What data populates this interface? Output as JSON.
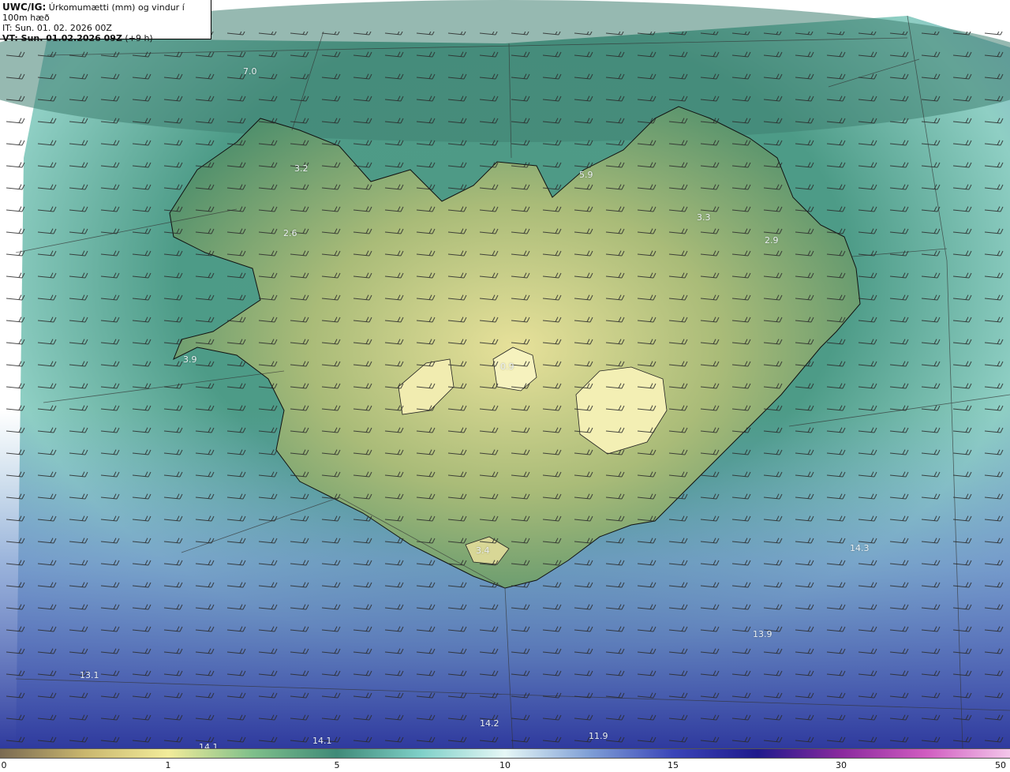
{
  "header": {
    "model": "UWC/IG:",
    "title": " Úrkomumætti (mm) og vindur í 100m hæð",
    "it_line": "IT: Sun. 01. 02. 2026 00Z",
    "vt_line": "VT: Sun. 01.02.2026 09Z",
    "vt_offset": " (+9 h)"
  },
  "value_labels": [
    "7.0",
    "3.2",
    "5.9",
    "3.3",
    "2.6",
    "2.9",
    "3.9",
    "0.9",
    "3.4",
    "14.3",
    "13.9",
    "13.1",
    "14.2",
    "14.1",
    "11.9",
    "14.1"
  ],
  "colorbar": {
    "ticks": [
      "0",
      "1",
      "5",
      "10",
      "15",
      "30",
      "50"
    ],
    "colors": [
      "#7a6a52",
      "#c9b66e",
      "#f2ec9a",
      "#7fbf8a",
      "#3f8a78",
      "#7fd0c8",
      "#e6f7f6",
      "#7f9fd6",
      "#3b45b8",
      "#1f1a8c",
      "#8a2a9e",
      "#d05cc0",
      "#f3c6ea"
    ]
  },
  "icons": {
    "wind-barb": "wind barb glyph"
  }
}
